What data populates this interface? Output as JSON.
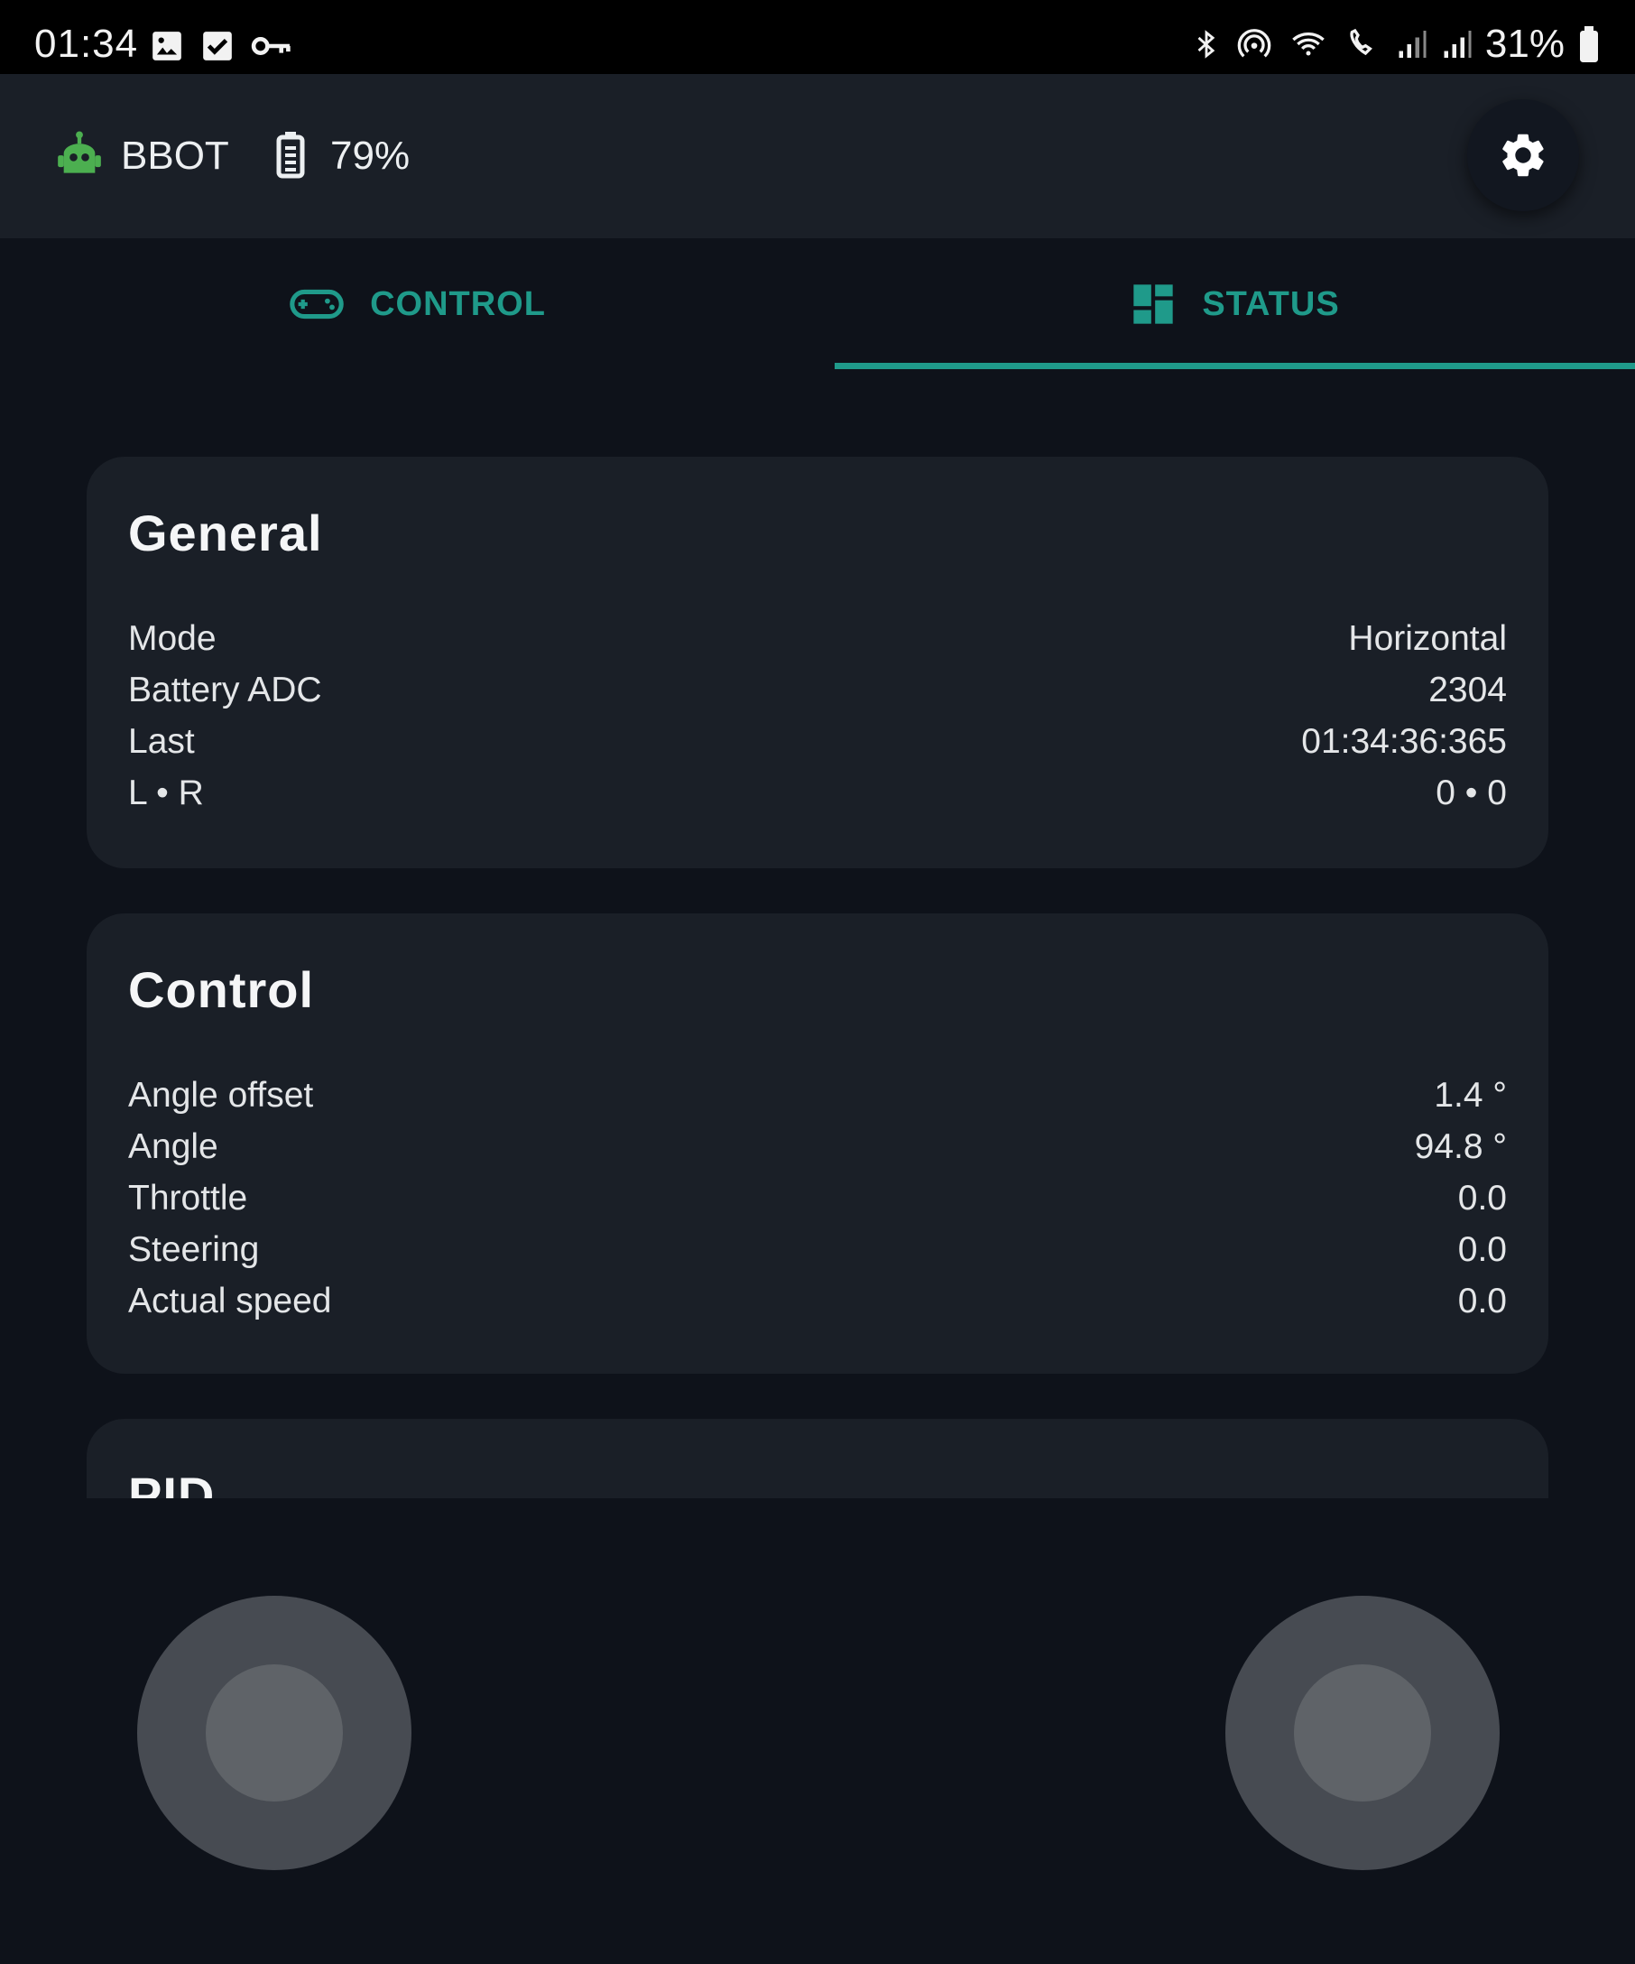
{
  "status_bar": {
    "time": "01:34",
    "battery": "31%"
  },
  "header": {
    "app_name": "BBOT",
    "robot_battery": "79%"
  },
  "tabs": [
    {
      "label": "CONTROL",
      "icon": "gamepad-icon",
      "selected": false
    },
    {
      "label": "STATUS",
      "icon": "dashboard-icon",
      "selected": true
    }
  ],
  "general": {
    "title": "General",
    "rows": [
      {
        "label": "Mode",
        "value": "Horizontal"
      },
      {
        "label": "Battery ADC",
        "value": "2304"
      },
      {
        "label": "Last",
        "value": "01:34:36:365"
      },
      {
        "label": "L • R",
        "value": "0 • 0"
      }
    ]
  },
  "control": {
    "title": "Control",
    "rows": [
      {
        "label": "Angle offset",
        "value": "1.4 °"
      },
      {
        "label": "Angle",
        "value": "94.8 °"
      },
      {
        "label": "Throttle",
        "value": "0.0"
      },
      {
        "label": "Steering",
        "value": "0.0"
      },
      {
        "label": "Actual speed",
        "value": "0.0"
      }
    ]
  },
  "pid": {
    "title": "PID"
  },
  "colors": {
    "accent": "#1f9a8a",
    "robot_icon": "#4caf50",
    "background": "#0e121a",
    "card": "#1a1f27"
  }
}
